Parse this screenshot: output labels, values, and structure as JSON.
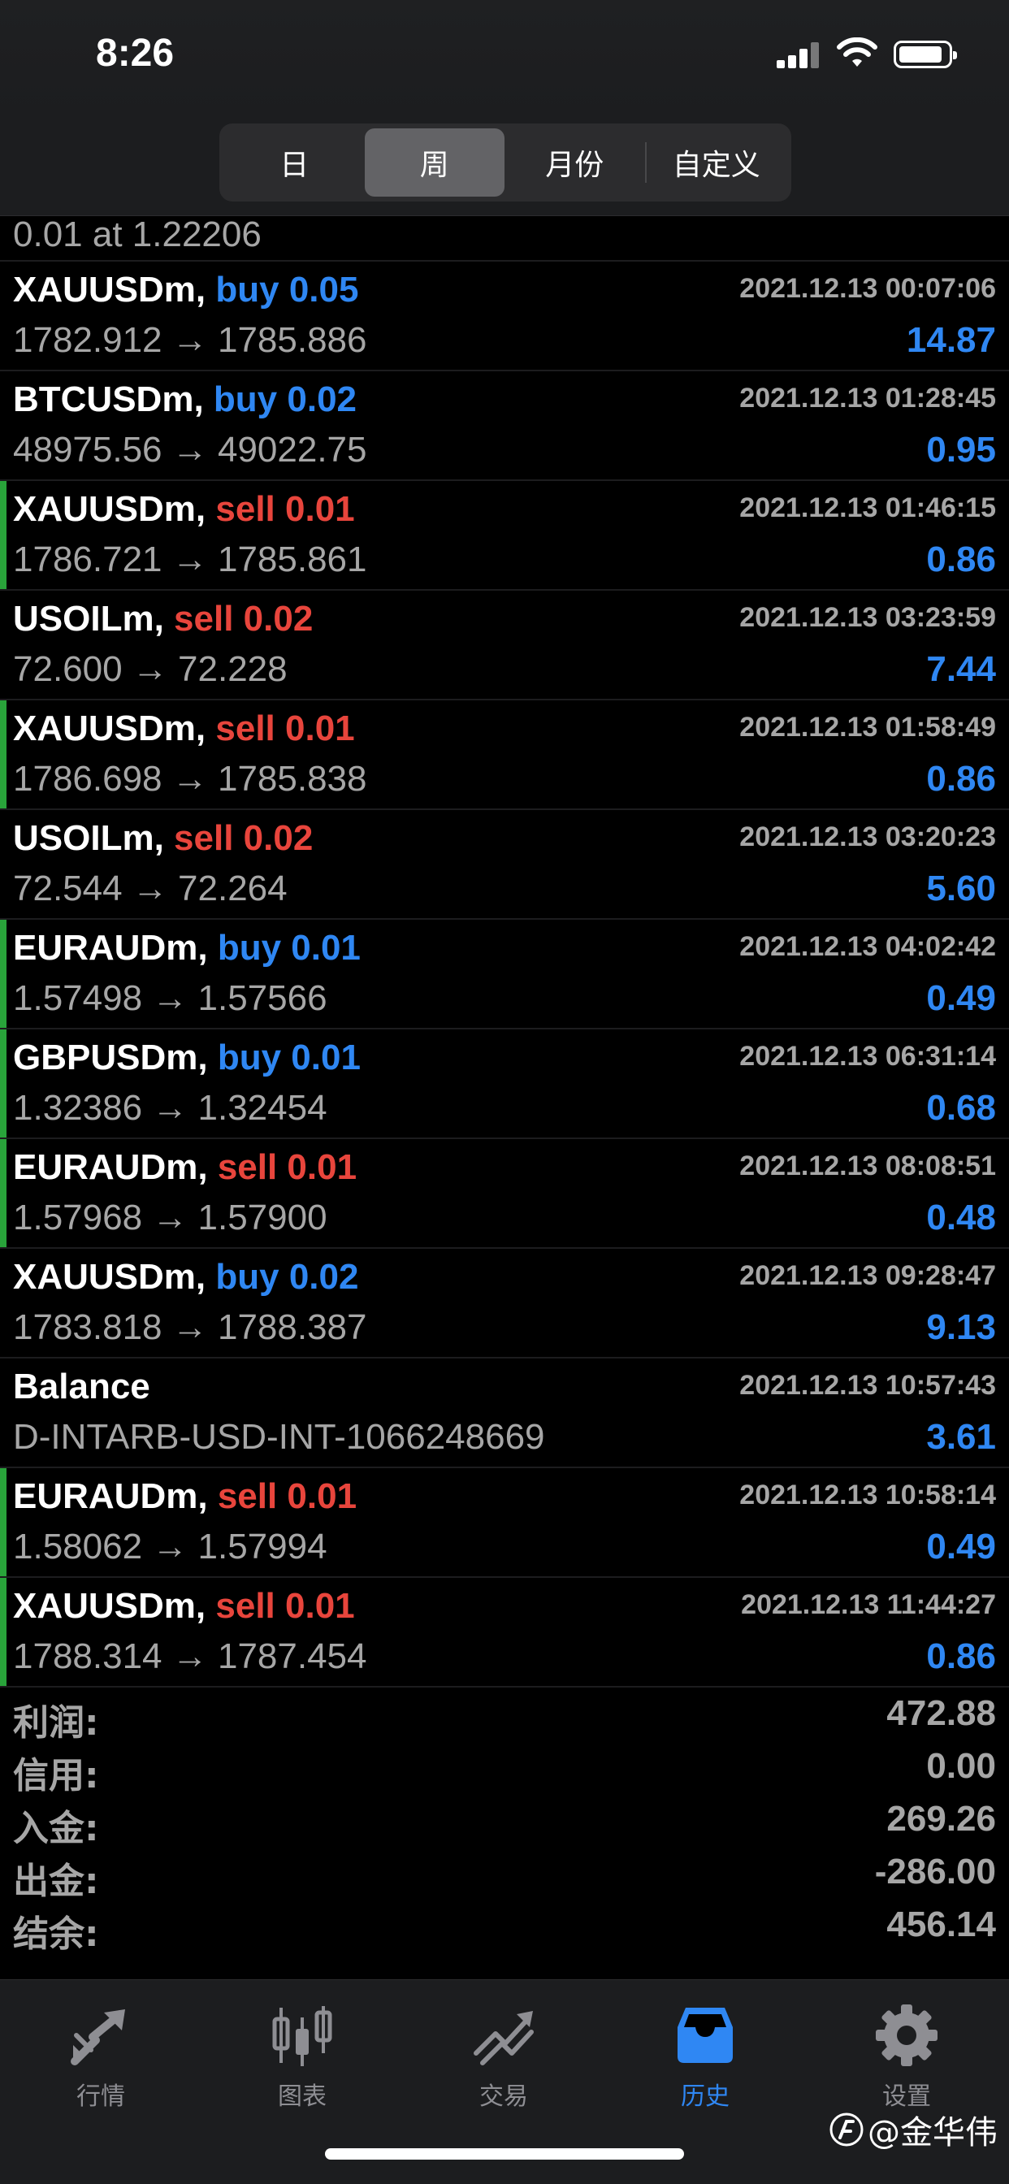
{
  "status_bar": {
    "time": "8:26"
  },
  "segments": [
    {
      "label": "日",
      "active": false
    },
    {
      "label": "周",
      "active": true
    },
    {
      "label": "月份",
      "active": false
    },
    {
      "label": "自定义",
      "active": false
    }
  ],
  "partial_row": {
    "line2": "0.01 at 1.22206"
  },
  "rows": [
    {
      "symbol": "XAUUSDm,",
      "side": "buy",
      "side_text": "buy 0.05",
      "time": "2021.12.13 00:07:06",
      "prices": "1782.912 → 1785.886",
      "profit": "14.87",
      "marker": false
    },
    {
      "symbol": "BTCUSDm,",
      "side": "buy",
      "side_text": "buy 0.02",
      "time": "2021.12.13 01:28:45",
      "prices": "48975.56 → 49022.75",
      "profit": "0.95",
      "marker": false
    },
    {
      "symbol": "XAUUSDm,",
      "side": "sell",
      "side_text": "sell 0.01",
      "time": "2021.12.13 01:46:15",
      "prices": "1786.721 → 1785.861",
      "profit": "0.86",
      "marker": true
    },
    {
      "symbol": "USOILm,",
      "side": "sell",
      "side_text": "sell 0.02",
      "time": "2021.12.13 03:23:59",
      "prices": "72.600 → 72.228",
      "profit": "7.44",
      "marker": false
    },
    {
      "symbol": "XAUUSDm,",
      "side": "sell",
      "side_text": "sell 0.01",
      "time": "2021.12.13 01:58:49",
      "prices": "1786.698 → 1785.838",
      "profit": "0.86",
      "marker": true
    },
    {
      "symbol": "USOILm,",
      "side": "sell",
      "side_text": "sell 0.02",
      "time": "2021.12.13 03:20:23",
      "prices": "72.544 → 72.264",
      "profit": "5.60",
      "marker": false
    },
    {
      "symbol": "EURAUDm,",
      "side": "buy",
      "side_text": "buy 0.01",
      "time": "2021.12.13 04:02:42",
      "prices": "1.57498 → 1.57566",
      "profit": "0.49",
      "marker": true
    },
    {
      "symbol": "GBPUSDm,",
      "side": "buy",
      "side_text": "buy 0.01",
      "time": "2021.12.13 06:31:14",
      "prices": "1.32386 → 1.32454",
      "profit": "0.68",
      "marker": true
    },
    {
      "symbol": "EURAUDm,",
      "side": "sell",
      "side_text": "sell 0.01",
      "time": "2021.12.13 08:08:51",
      "prices": "1.57968 → 1.57900",
      "profit": "0.48",
      "marker": true
    },
    {
      "symbol": "XAUUSDm,",
      "side": "buy",
      "side_text": "buy 0.02",
      "time": "2021.12.13 09:28:47",
      "prices": "1783.818 → 1788.387",
      "profit": "9.13",
      "marker": false
    },
    {
      "symbol": "Balance",
      "side": "",
      "side_text": "",
      "time": "2021.12.13 10:57:43",
      "prices": "D-INTARB-USD-INT-1066248669",
      "profit": "3.61",
      "marker": false
    },
    {
      "symbol": "EURAUDm,",
      "side": "sell",
      "side_text": "sell 0.01",
      "time": "2021.12.13 10:58:14",
      "prices": "1.58062 → 1.57994",
      "profit": "0.49",
      "marker": true
    },
    {
      "symbol": "XAUUSDm,",
      "side": "sell",
      "side_text": "sell 0.01",
      "time": "2021.12.13 11:44:27",
      "prices": "1788.314 → 1787.454",
      "profit": "0.86",
      "marker": true
    }
  ],
  "summary": [
    {
      "label": "利润:",
      "value": "472.88"
    },
    {
      "label": "信用:",
      "value": "0.00"
    },
    {
      "label": "入金:",
      "value": "269.26"
    },
    {
      "label": "出金:",
      "value": "-286.00"
    },
    {
      "label": "结余:",
      "value": "456.14"
    }
  ],
  "tabs": [
    {
      "label": "行情",
      "icon": "quotes-icon",
      "active": false
    },
    {
      "label": "图表",
      "icon": "chart-icon",
      "active": false
    },
    {
      "label": "交易",
      "icon": "trade-icon",
      "active": false
    },
    {
      "label": "历史",
      "icon": "history-icon",
      "active": true
    },
    {
      "label": "设置",
      "icon": "settings-icon",
      "active": false
    }
  ],
  "watermark": "@金华伟",
  "colors": {
    "buy": "#2f87f3",
    "sell": "#e8453c",
    "marker": "#29a33a",
    "active_tab": "#2f87f3"
  }
}
